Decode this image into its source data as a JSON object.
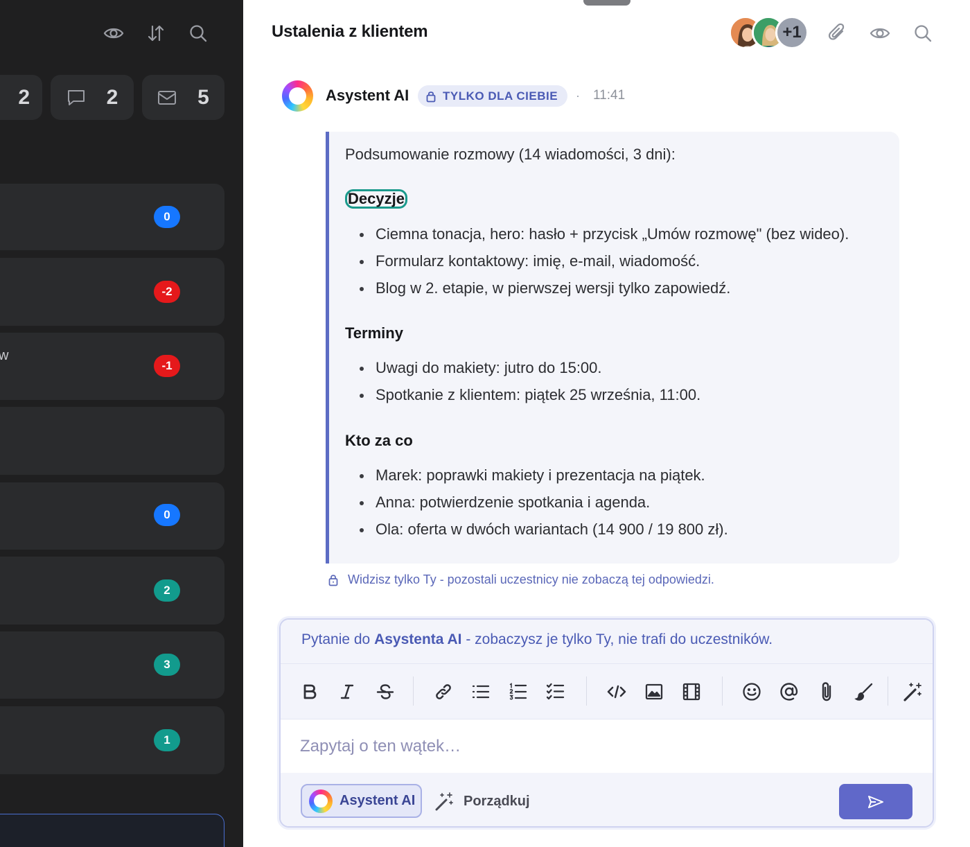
{
  "sidebar": {
    "stats": [
      {
        "icon": "tasks-icon",
        "count": "2"
      },
      {
        "icon": "comment-icon",
        "count": "2"
      },
      {
        "icon": "mail-icon",
        "count": "5"
      }
    ],
    "cards": [
      {
        "badge": "0",
        "color": "#1677ff",
        "text": ""
      },
      {
        "badge": "-2",
        "color": "#e5191b",
        "text": ""
      },
      {
        "badge": "-1",
        "color": "#e5191b",
        "text": "w"
      },
      {
        "badge": "",
        "color": "",
        "text": ""
      },
      {
        "badge": "0",
        "color": "#1677ff",
        "text": ""
      },
      {
        "badge": "2",
        "color": "#129b8d",
        "text": ""
      },
      {
        "badge": "3",
        "color": "#129b8d",
        "text": ""
      },
      {
        "badge": "1",
        "color": "#129b8d",
        "text": ""
      }
    ]
  },
  "thread": {
    "title": "Ustalenia z klientem",
    "extra_members": "+1"
  },
  "message": {
    "sender": "Asystent AI",
    "visibility": "TYLKO DLA CIEBIE",
    "separator": "·",
    "time": "11:41",
    "intro": "Podsumowanie rozmowy (14 wiadomości, 3 dni):",
    "sections": [
      {
        "heading": "Decyzje",
        "items": [
          "Ciemna tonacja, hero: hasło + przycisk „Umów rozmowę\" (bez wideo).",
          "Formularz kontaktowy: imię, e-mail, wiadomość.",
          "Blog w 2. etapie, w pierwszej wersji tylko zapowiedź."
        ]
      },
      {
        "heading": "Terminy",
        "items": [
          "Uwagi do makiety: jutro do 15:00.",
          "Spotkanie z klientem: piątek 25 września, 11:00."
        ]
      },
      {
        "heading": "Kto za co",
        "items": [
          "Marek: poprawki makiety i prezentacja na piątek.",
          "Anna: potwierdzenie spotkania i agenda.",
          "Ola: oferta w dwóch wariantach (14 900 / 19 800 zł)."
        ]
      }
    ],
    "notice": "Widzisz tylko Ty - pozostali uczestnicy nie zobaczą tej odpowiedzi."
  },
  "composer": {
    "hint_prefix": "Pytanie do ",
    "hint_bold": "Asystenta AI",
    "hint_suffix": " - zobaczysz je tylko Ty, nie trafi do uczestników.",
    "placeholder": "Zapytaj o ten wątek…",
    "ai_button": "Asystent AI",
    "tidy_button": "Porządkuj",
    "accent": "#6068c9"
  }
}
